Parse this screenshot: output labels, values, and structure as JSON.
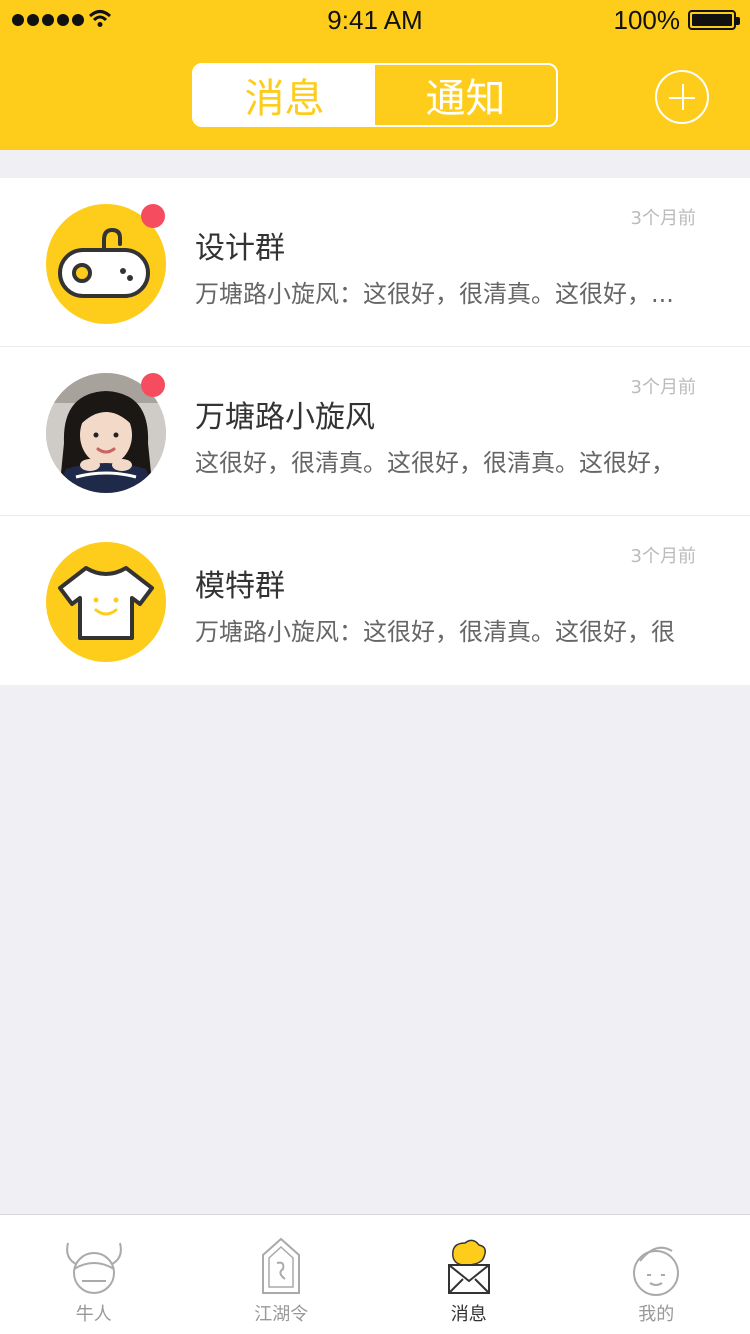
{
  "status_bar": {
    "time": "9:41 AM",
    "battery": "100%"
  },
  "header": {
    "tabs": [
      {
        "label": "消息",
        "active": true
      },
      {
        "label": "通知",
        "active": false
      }
    ],
    "accent_color": "#fecc1a"
  },
  "conversations": [
    {
      "name": "设计群",
      "preview": "万塘路小旋风：这很好，很清真。这很好，...",
      "time": "3个月前",
      "unread": true,
      "avatar": "gamepad-icon"
    },
    {
      "name": "万塘路小旋风",
      "preview": "这很好，很清真。这很好，很清真。这很好，",
      "time": "3个月前",
      "unread": true,
      "avatar": "user-photo"
    },
    {
      "name": "模特群",
      "preview": "万塘路小旋风：这很好，很清真。这很好，很",
      "time": "3个月前",
      "unread": false,
      "avatar": "tshirt-icon"
    }
  ],
  "tabbar": {
    "items": [
      {
        "label": "牛人",
        "icon": "bull-head-icon",
        "active": false
      },
      {
        "label": "江湖令",
        "icon": "token-icon",
        "active": false
      },
      {
        "label": "消息",
        "icon": "bird-envelope-icon",
        "active": true
      },
      {
        "label": "我的",
        "icon": "face-icon",
        "active": false
      }
    ]
  }
}
